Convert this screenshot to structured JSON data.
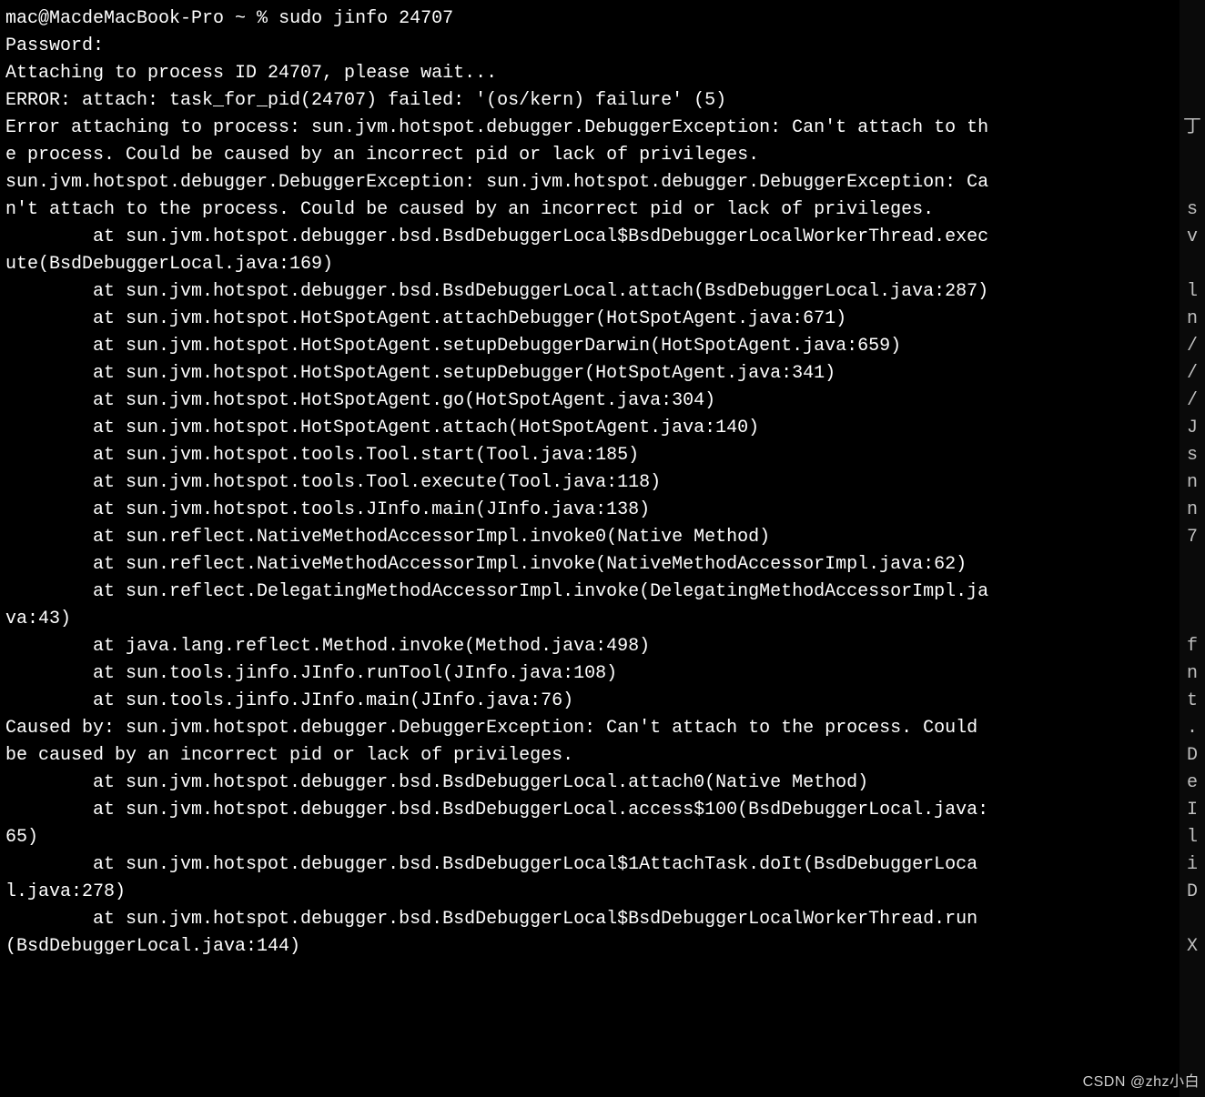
{
  "terminal": {
    "prompt": "mac@MacdeMacBook-Pro ~ % ",
    "command": "sudo jinfo 24707",
    "lines": [
      "Password:",
      "Attaching to process ID 24707, please wait...",
      "ERROR: attach: task_for_pid(24707) failed: '(os/kern) failure' (5)",
      "Error attaching to process: sun.jvm.hotspot.debugger.DebuggerException: Can't attach to the process. Could be caused by an incorrect pid or lack of privileges.",
      "sun.jvm.hotspot.debugger.DebuggerException: sun.jvm.hotspot.debugger.DebuggerException: Can't attach to the process. Could be caused by an incorrect pid or lack of privileges.",
      "        at sun.jvm.hotspot.debugger.bsd.BsdDebuggerLocal$BsdDebuggerLocalWorkerThread.execute(BsdDebuggerLocal.java:169)",
      "        at sun.jvm.hotspot.debugger.bsd.BsdDebuggerLocal.attach(BsdDebuggerLocal.java:287)",
      "        at sun.jvm.hotspot.HotSpotAgent.attachDebugger(HotSpotAgent.java:671)",
      "        at sun.jvm.hotspot.HotSpotAgent.setupDebuggerDarwin(HotSpotAgent.java:659)",
      "        at sun.jvm.hotspot.HotSpotAgent.setupDebugger(HotSpotAgent.java:341)",
      "        at sun.jvm.hotspot.HotSpotAgent.go(HotSpotAgent.java:304)",
      "        at sun.jvm.hotspot.HotSpotAgent.attach(HotSpotAgent.java:140)",
      "        at sun.jvm.hotspot.tools.Tool.start(Tool.java:185)",
      "        at sun.jvm.hotspot.tools.Tool.execute(Tool.java:118)",
      "        at sun.jvm.hotspot.tools.JInfo.main(JInfo.java:138)",
      "        at sun.reflect.NativeMethodAccessorImpl.invoke0(Native Method)",
      "        at sun.reflect.NativeMethodAccessorImpl.invoke(NativeMethodAccessorImpl.java:62)",
      "        at sun.reflect.DelegatingMethodAccessorImpl.invoke(DelegatingMethodAccessorImpl.java:43)",
      "        at java.lang.reflect.Method.invoke(Method.java:498)",
      "        at sun.tools.jinfo.JInfo.runTool(JInfo.java:108)",
      "        at sun.tools.jinfo.JInfo.main(JInfo.java:76)",
      "Caused by: sun.jvm.hotspot.debugger.DebuggerException: Can't attach to the process. Could be caused by an incorrect pid or lack of privileges.",
      "        at sun.jvm.hotspot.debugger.bsd.BsdDebuggerLocal.attach0(Native Method)",
      "        at sun.jvm.hotspot.debugger.bsd.BsdDebuggerLocal.access$100(BsdDebuggerLocal.java:65)",
      "        at sun.jvm.hotspot.debugger.bsd.BsdDebuggerLocal$1AttachTask.doIt(BsdDebuggerLocal.java:278)",
      "        at sun.jvm.hotspot.debugger.bsd.BsdDebuggerLocal$BsdDebuggerLocalWorkerThread.run(BsdDebuggerLocal.java:144)"
    ]
  },
  "right_strip": [
    "",
    "",
    "",
    "",
    "丁",
    "",
    "",
    "s",
    "v",
    "",
    "l",
    "n",
    "/",
    "/",
    "/",
    "J",
    "s",
    "n",
    "n",
    "7",
    "",
    "",
    "",
    "f",
    "n",
    "t",
    ".",
    "D",
    "e",
    "I",
    "l",
    "i",
    "D",
    "",
    "X"
  ],
  "watermark": "CSDN @zhz小白"
}
